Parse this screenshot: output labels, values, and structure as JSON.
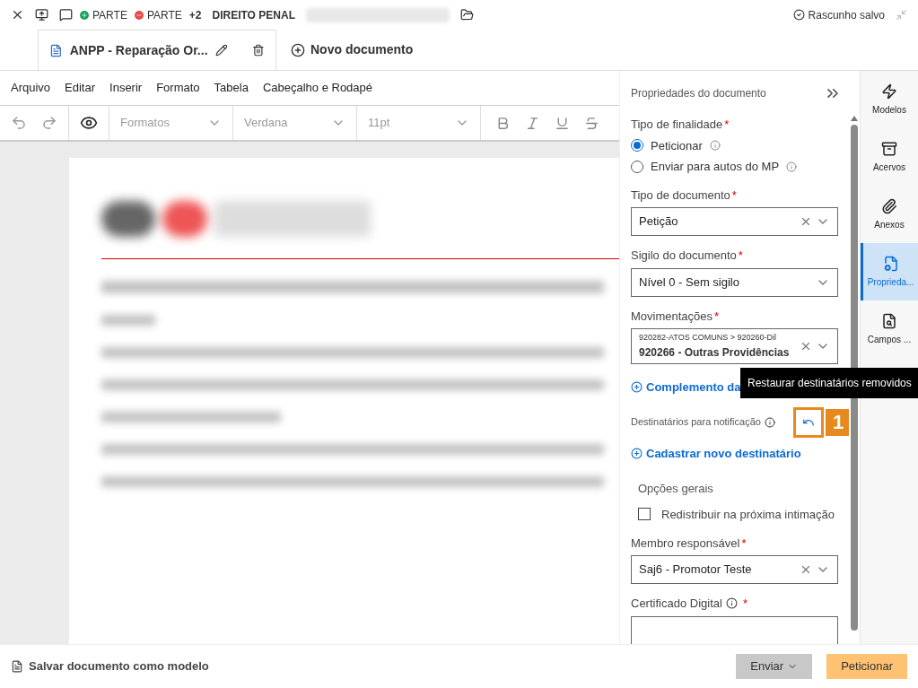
{
  "top_bar": {
    "parties": [
      {
        "label": "PARTE",
        "kind": "add"
      },
      {
        "label": "PARTE",
        "kind": "remove"
      }
    ],
    "extra_count": "+2",
    "area": "DIREITO PENAL",
    "status": "Rascunho salvo"
  },
  "document_tabs": [
    {
      "label": "ANPP - Reparação Or...",
      "selected": true
    }
  ],
  "new_document": "Novo documento",
  "menu": [
    "Arquivo",
    "Editar",
    "Inserir",
    "Formato",
    "Tabela",
    "Cabeçalho e Rodapé"
  ],
  "toolbar": {
    "format": "Formatos",
    "font": "Verdana",
    "size": "11pt"
  },
  "properties": {
    "title": "Propriedades do documento",
    "finality": {
      "label": "Tipo de finalidade",
      "required_mark": "*",
      "options": [
        {
          "label": "Peticionar",
          "selected": true
        },
        {
          "label": "Enviar para autos do MP",
          "selected": false
        }
      ]
    },
    "document_type": {
      "label": "Tipo de documento",
      "required_mark": "*",
      "value": "Petição",
      "clearable": true
    },
    "secrecy": {
      "label": "Sigilo do documento",
      "required_mark": "*",
      "value": "Nível 0 - Sem sigilo",
      "clearable": false
    },
    "movements": {
      "label": "Movimentações",
      "required_mark": "*",
      "path": "920282-ATOS COMUNS > 920260-Dil",
      "value": "920266 - Outras Providências"
    },
    "complement_link": "Complemento da",
    "recipients_label": "Destinatários para notificação",
    "tooltip": "Restaurar destinatários removidos",
    "callout": "1",
    "new_recipient_link": "Cadastrar novo destinatário",
    "general_options": "Opções gerais",
    "redistribute": {
      "label": "Redistribuir na próxima intimação",
      "checked": false
    },
    "member": {
      "label": "Membro responsável",
      "required_mark": "*",
      "value": "Saj6 - Promotor Teste",
      "clearable": true
    },
    "certificate": {
      "label": "Certificado Digital",
      "required_mark": "*"
    }
  },
  "side_rail": [
    {
      "label": "Modelos",
      "kind": "bolt",
      "selected": false
    },
    {
      "label": "Acervos",
      "kind": "archive",
      "selected": false
    },
    {
      "label": "Anexos",
      "kind": "clip",
      "selected": false
    },
    {
      "label": "Proprieda...",
      "kind": "props",
      "selected": true
    },
    {
      "label": "Campos ...",
      "kind": "search",
      "selected": false
    }
  ],
  "footer": {
    "save_model": "Salvar documento como modelo",
    "send": "Enviar",
    "submit": "Peticionar"
  }
}
